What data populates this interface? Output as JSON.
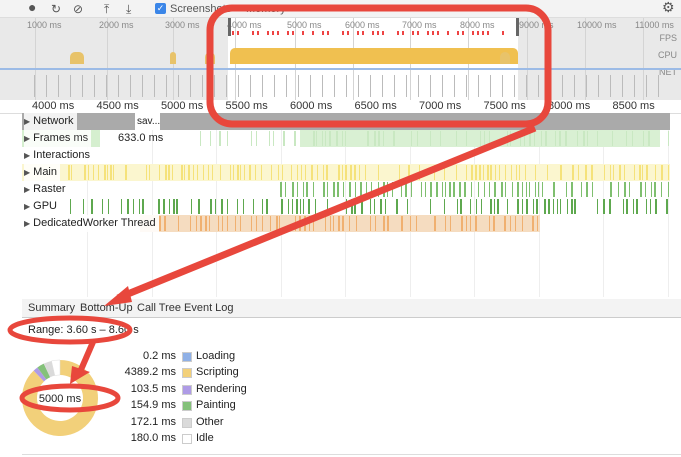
{
  "toolbar": {
    "record": "record-icon",
    "reload": "reload-icon",
    "clear": "clear-icon",
    "upload": "upload-icon",
    "download": "download-icon",
    "screenshots_label": "Screenshots",
    "screenshots_checked": true,
    "memory_label": "Memory"
  },
  "overview": {
    "ticks": [
      "1000 ms",
      "2000 ms",
      "3000 ms",
      "4000 ms",
      "5000 ms",
      "6000 ms",
      "7000 ms",
      "8000 ms",
      "9000 ms",
      "10000 ms",
      "11000 ms"
    ],
    "labels": [
      "FPS",
      "CPU",
      "NET"
    ]
  },
  "ruler": {
    "ticks": [
      "4000 ms",
      "4500 ms",
      "5000 ms",
      "5500 ms",
      "6000 ms",
      "6500 ms",
      "7000 ms",
      "7500 ms",
      "8000 ms",
      "8500 ms"
    ]
  },
  "tracks": {
    "network": "Network",
    "network_item": "sav...",
    "frames": "Frames",
    "frames_ms": "ms",
    "frames_value": "633.0 ms",
    "interactions": "Interactions",
    "main": "Main",
    "raster": "Raster",
    "gpu": "GPU",
    "worker": "DedicatedWorker Thread"
  },
  "tabs": [
    "Summary",
    "Bottom-Up",
    "Call Tree",
    "Event Log"
  ],
  "summary": {
    "range": "Range: 3.60 s – 8.60 s",
    "total": "5000 ms",
    "items": [
      {
        "value": "0.2 ms",
        "label": "Loading",
        "ms": 0.2,
        "color": "#8fb0e6"
      },
      {
        "value": "4389.2 ms",
        "label": "Scripting",
        "ms": 4389.2,
        "color": "#f2d07a"
      },
      {
        "value": "103.5 ms",
        "label": "Rendering",
        "ms": 103.5,
        "color": "#ae9be6"
      },
      {
        "value": "154.9 ms",
        "label": "Painting",
        "ms": 154.9,
        "color": "#84c17a"
      },
      {
        "value": "172.1 ms",
        "label": "Other",
        "ms": 172.1,
        "color": "#dadada"
      },
      {
        "value": "180.0 ms",
        "label": "Idle",
        "ms": 180.0,
        "color": "#ffffff"
      }
    ]
  },
  "colors": {
    "annotation": "#e8473c",
    "scripting": "#f2d07a",
    "painting": "#84c17a"
  }
}
